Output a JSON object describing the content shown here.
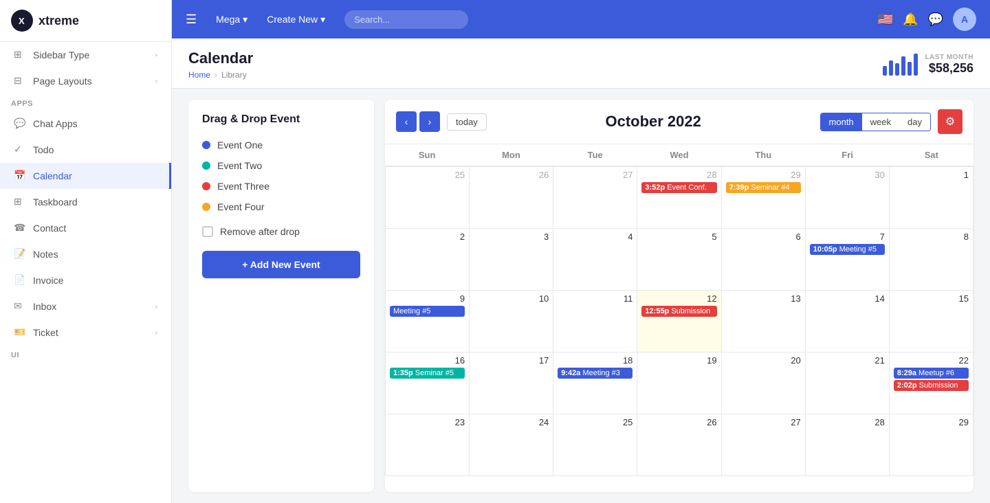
{
  "app": {
    "logo": "X",
    "name": "xtreme"
  },
  "topbar": {
    "menu_icon": "☰",
    "brand": "Mega",
    "create_label": "Create New",
    "search_placeholder": "Search...",
    "flag": "🇺🇸"
  },
  "sidebar": {
    "section_apps": "APPS",
    "section_ui": "UI",
    "items": [
      {
        "id": "sidebar-type",
        "label": "Sidebar Type",
        "icon": "⊞",
        "has_arrow": true
      },
      {
        "id": "page-layouts",
        "label": "Page Layouts",
        "icon": "⊟",
        "has_arrow": true
      },
      {
        "id": "chat-apps",
        "label": "Chat Apps",
        "icon": "💬",
        "has_arrow": false
      },
      {
        "id": "todo",
        "label": "Todo",
        "icon": "✓",
        "has_arrow": false
      },
      {
        "id": "calendar",
        "label": "Calendar",
        "icon": "📅",
        "has_arrow": false,
        "active": true
      },
      {
        "id": "taskboard",
        "label": "Taskboard",
        "icon": "⊞",
        "has_arrow": false
      },
      {
        "id": "contact",
        "label": "Contact",
        "icon": "☎",
        "has_arrow": false
      },
      {
        "id": "notes",
        "label": "Notes",
        "icon": "📝",
        "has_arrow": false
      },
      {
        "id": "invoice",
        "label": "Invoice",
        "icon": "📄",
        "has_arrow": false
      },
      {
        "id": "inbox",
        "label": "Inbox",
        "icon": "✉",
        "has_arrow": true
      },
      {
        "id": "ticket",
        "label": "Ticket",
        "icon": "🎫",
        "has_arrow": true
      }
    ]
  },
  "page": {
    "title": "Calendar",
    "breadcrumb_home": "Home",
    "breadcrumb_current": "Library"
  },
  "last_month": {
    "label": "LAST MONTH",
    "value": "$58,256",
    "bars": [
      14,
      22,
      18,
      28,
      20,
      32
    ]
  },
  "left_panel": {
    "title": "Drag & Drop Event",
    "events": [
      {
        "id": "event-one",
        "label": "Event One",
        "color": "#3b5bdb"
      },
      {
        "id": "event-two",
        "label": "Event Two",
        "color": "#00b5a3"
      },
      {
        "id": "event-three",
        "label": "Event Three",
        "color": "#e53e3e"
      },
      {
        "id": "event-four",
        "label": "Event Four",
        "color": "#f6a623"
      }
    ],
    "remove_after_drop": "Remove after drop",
    "add_button": "+ Add New Event"
  },
  "calendar": {
    "month_title": "October 2022",
    "today_label": "today",
    "view_buttons": [
      "month",
      "week",
      "day"
    ],
    "active_view": "month",
    "day_headers": [
      "Sun",
      "Mon",
      "Tue",
      "Wed",
      "Thu",
      "Fri",
      "Sat"
    ],
    "prev_icon": "‹",
    "next_icon": "›",
    "weeks": [
      [
        {
          "date": "25",
          "current": false,
          "highlight": false,
          "events": []
        },
        {
          "date": "26",
          "current": false,
          "highlight": false,
          "events": []
        },
        {
          "date": "27",
          "current": false,
          "highlight": false,
          "events": []
        },
        {
          "date": "28",
          "current": false,
          "highlight": false,
          "events": [
            {
              "time": "3:52p",
              "label": "Event Conf.",
              "color": "event-red"
            }
          ]
        },
        {
          "date": "29",
          "current": false,
          "highlight": false,
          "events": [
            {
              "time": "7:39p",
              "label": "Seminar #4",
              "color": "event-orange",
              "span": 3
            }
          ]
        },
        {
          "date": "30",
          "current": false,
          "highlight": false,
          "events": []
        },
        {
          "date": "1",
          "current": true,
          "highlight": false,
          "events": []
        }
      ],
      [
        {
          "date": "2",
          "current": true,
          "highlight": false,
          "events": []
        },
        {
          "date": "3",
          "current": true,
          "highlight": false,
          "events": []
        },
        {
          "date": "4",
          "current": true,
          "highlight": false,
          "events": []
        },
        {
          "date": "5",
          "current": true,
          "highlight": false,
          "events": []
        },
        {
          "date": "6",
          "current": true,
          "highlight": false,
          "events": []
        },
        {
          "date": "7",
          "current": true,
          "highlight": false,
          "events": [
            {
              "time": "10:05p",
              "label": "Meeting #5",
              "color": "event-blue",
              "span": 2
            }
          ]
        },
        {
          "date": "8",
          "current": true,
          "highlight": false,
          "events": []
        }
      ],
      [
        {
          "date": "9",
          "current": true,
          "highlight": false,
          "events": [
            {
              "time": "",
              "label": "Meeting #5",
              "color": "event-blue"
            }
          ]
        },
        {
          "date": "10",
          "current": true,
          "highlight": false,
          "events": []
        },
        {
          "date": "11",
          "current": true,
          "highlight": false,
          "events": []
        },
        {
          "date": "12",
          "current": true,
          "highlight": true,
          "events": [
            {
              "time": "12:55p",
              "label": "Submission",
              "color": "event-red"
            }
          ]
        },
        {
          "date": "13",
          "current": true,
          "highlight": false,
          "events": []
        },
        {
          "date": "14",
          "current": true,
          "highlight": false,
          "events": []
        },
        {
          "date": "15",
          "current": true,
          "highlight": false,
          "events": []
        }
      ],
      [
        {
          "date": "16",
          "current": true,
          "highlight": false,
          "events": [
            {
              "time": "1:35p",
              "label": "Seminar #5",
              "color": "event-teal"
            }
          ]
        },
        {
          "date": "17",
          "current": true,
          "highlight": false,
          "events": []
        },
        {
          "date": "18",
          "current": true,
          "highlight": false,
          "events": [
            {
              "time": "9:42a",
              "label": "Meeting #3",
              "color": "event-blue"
            }
          ]
        },
        {
          "date": "19",
          "current": true,
          "highlight": false,
          "events": []
        },
        {
          "date": "20",
          "current": true,
          "highlight": false,
          "events": []
        },
        {
          "date": "21",
          "current": true,
          "highlight": false,
          "events": []
        },
        {
          "date": "22",
          "current": true,
          "highlight": false,
          "events": [
            {
              "time": "8:29a",
              "label": "Meetup #6",
              "color": "event-blue"
            },
            {
              "time": "2:02p",
              "label": "Submission",
              "color": "event-red"
            }
          ]
        }
      ],
      [
        {
          "date": "23",
          "current": true,
          "highlight": false,
          "events": []
        },
        {
          "date": "24",
          "current": true,
          "highlight": false,
          "events": []
        },
        {
          "date": "25",
          "current": true,
          "highlight": false,
          "events": []
        },
        {
          "date": "26",
          "current": true,
          "highlight": false,
          "events": []
        },
        {
          "date": "27",
          "current": true,
          "highlight": false,
          "events": []
        },
        {
          "date": "28",
          "current": true,
          "highlight": false,
          "events": []
        },
        {
          "date": "29",
          "current": true,
          "highlight": false,
          "events": []
        }
      ]
    ]
  }
}
